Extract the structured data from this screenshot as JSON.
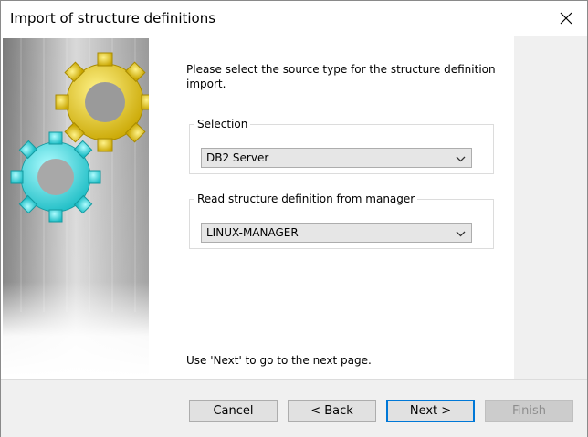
{
  "window": {
    "title": "Import of structure definitions",
    "close_icon": "close-icon"
  },
  "intro_text": "Please select the source type for the structure definition import.",
  "selection_group": {
    "legend": "Selection",
    "selected": "DB2 Server"
  },
  "manager_group": {
    "legend": "Read structure definition from manager",
    "selected": "LINUX-MANAGER"
  },
  "hint_text": "Use 'Next' to go to the next page.",
  "buttons": {
    "cancel": "Cancel",
    "back": "< Back",
    "next": "Next >",
    "finish": "Finish"
  },
  "colors": {
    "accent": "#0078d7",
    "gear_yellow": "#e6cc1a",
    "gear_cyan": "#2fe0e0"
  }
}
